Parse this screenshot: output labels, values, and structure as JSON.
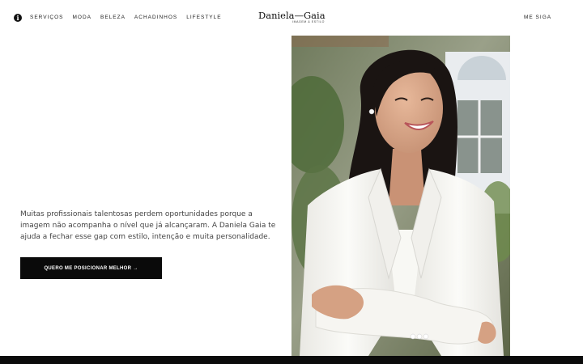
{
  "header": {
    "info_icon": "info-icon",
    "nav": [
      {
        "label": "SERVIÇOS"
      },
      {
        "label": "MODA"
      },
      {
        "label": "BELEZA"
      },
      {
        "label": "ACHADINHOS"
      },
      {
        "label": "LIFESTYLE"
      }
    ],
    "logo": {
      "name": "Daniela—Gaia",
      "tagline": "IMAGEM & ESTILO"
    },
    "follow_label": "ME SIGA"
  },
  "hero": {
    "text": "Muitas profissionais talentosas perdem oportunidades porque a imagem não acompanha o nível que já alcançaram. A Daniela Gaia te ajuda a fechar esse gap com estilo, intenção e muita personalidade.",
    "cta_label": "QUERO ME POSICIONAR MELHOR →"
  },
  "colors": {
    "background": "#ffffff",
    "text": "#444444",
    "button_bg": "#0a0a0a",
    "button_text": "#ffffff",
    "blazer": "#f7f6f2"
  }
}
